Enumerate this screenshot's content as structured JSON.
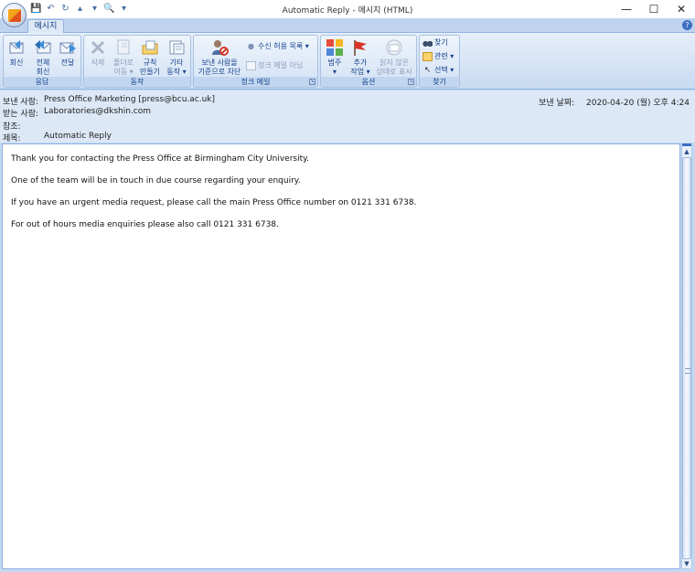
{
  "window": {
    "title": "Automatic Reply - 메시지 (HTML)",
    "controls": [
      "—",
      "☐",
      "✕"
    ]
  },
  "tabs": {
    "message": "메시지"
  },
  "ribbon": {
    "respond": {
      "label": "응답",
      "reply": "회신",
      "reply_all_1": "전체",
      "reply_all_2": "회신",
      "forward": "전달"
    },
    "actions": {
      "label": "동작",
      "delete": "삭제",
      "move_1": "폴더로",
      "move_2": "이동 ▾",
      "rules_1": "규칙",
      "rules_2": "만들기",
      "other_1": "기타",
      "other_2": "동작 ▾"
    },
    "junk": {
      "label": "정크 메일",
      "block_1": "보낸 사람을",
      "block_2": "기준으로 차단",
      "safe_lists": "수신 허용 목록 ▾",
      "not_junk": "정크 메일 아님"
    },
    "options": {
      "label": "옵션",
      "categorize_1": "범주",
      "categorize_2": "▾",
      "followup_1": "추가",
      "followup_2": "작업 ▾",
      "unread_1": "읽지 않은",
      "unread_2": "상태로 표시"
    },
    "find": {
      "label": "찾기",
      "find": "찾기",
      "related": "관련 ▾",
      "select": "선택 ▾"
    }
  },
  "header": {
    "from_label": "보낸 사람:",
    "from_value": "Press Office Marketing [press@bcu.ac.uk]",
    "to_label": "받는 사람:",
    "to_value": "Laboratories@dkshin.com",
    "cc_label": "참조:",
    "cc_value": "",
    "subject_label": "제목:",
    "subject_value": "Automatic Reply",
    "sent_label": "보낸 날짜:",
    "sent_value": "2020-04-20 (월) 오후 4:24"
  },
  "body": {
    "p1": "Thank you for contacting the Press Office at Birmingham City University.",
    "p2": "One of the team will be in touch in due course regarding your enquiry.",
    "p3": "If you have an urgent media request, please call the main Press Office number on 0121 331 6738.",
    "p4": "For out of hours media enquiries please also call 0121 331 6738."
  }
}
